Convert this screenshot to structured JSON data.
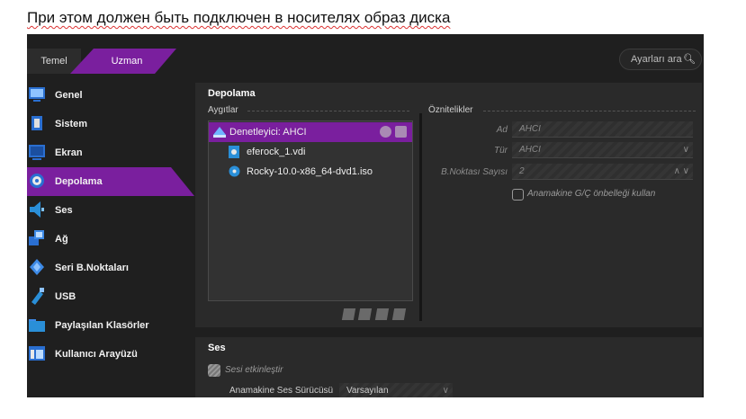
{
  "caption": "При этом должен быть подключен в носителях образ диска",
  "tabs": {
    "basic": "Temel",
    "expert": "Uzman"
  },
  "search": {
    "placeholder": "Ayarları ara"
  },
  "sidebar": {
    "items": [
      {
        "label": "Genel",
        "icon": "monitor-icon"
      },
      {
        "label": "Sistem",
        "icon": "chip-icon"
      },
      {
        "label": "Ekran",
        "icon": "display-icon"
      },
      {
        "label": "Depolama",
        "icon": "storage-disc-icon",
        "active": true
      },
      {
        "label": "Ses",
        "icon": "speaker-icon"
      },
      {
        "label": "Ağ",
        "icon": "network-icon"
      },
      {
        "label": "Seri B.Noktaları",
        "icon": "serial-port-icon"
      },
      {
        "label": "USB",
        "icon": "usb-icon"
      },
      {
        "label": "Paylaşılan Klasörler",
        "icon": "folder-icon"
      },
      {
        "label": "Kullanıcı Arayüzü",
        "icon": "ui-window-icon"
      }
    ]
  },
  "storage": {
    "title": "Depolama",
    "devices_label": "Aygıtlar",
    "attributes_label": "Öznitelikler",
    "tree": {
      "controller": "Denetleyici: AHCI",
      "items": [
        "eferock_1.vdi",
        "Rocky-10.0-x86_64-dvd1.iso"
      ]
    },
    "attributes": {
      "name_label": "Ad",
      "name_value": "AHCI",
      "type_label": "Tür",
      "type_value": "AHCI",
      "ports_label": "B.Noktası Sayısı",
      "ports_value": "2",
      "host_cache_label": "Anamakine G/Ç önbelleği kullan"
    }
  },
  "audio": {
    "title": "Ses",
    "enable_label": "Sesi etkinleştir",
    "host_driver_label": "Anamakine Ses Sürücüsü",
    "host_driver_value": "Varsayılan"
  },
  "colors": {
    "accent": "#7a1f9e",
    "background": "#1f1f1f",
    "panel": "#2a2a2a"
  }
}
